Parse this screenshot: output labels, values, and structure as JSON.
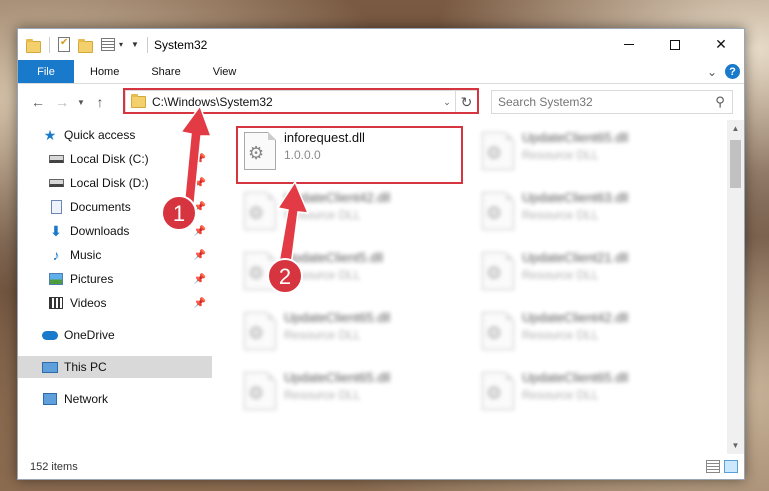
{
  "window": {
    "title": "System32"
  },
  "ribbon": {
    "tabs": [
      "File",
      "Home",
      "Share",
      "View"
    ],
    "help": "?"
  },
  "nav": {
    "address": "C:\\Windows\\System32",
    "search_placeholder": "Search System32"
  },
  "sidebar": {
    "items": [
      {
        "label": "Quick access",
        "icon": "star-icon"
      },
      {
        "label": "Local Disk (C:)",
        "icon": "disk-icon"
      },
      {
        "label": "Local Disk (D:)",
        "icon": "disk-icon"
      },
      {
        "label": "Documents",
        "icon": "documents-icon"
      },
      {
        "label": "Downloads",
        "icon": "download-icon"
      },
      {
        "label": "Music",
        "icon": "music-icon"
      },
      {
        "label": "Pictures",
        "icon": "pictures-icon"
      },
      {
        "label": "Videos",
        "icon": "videos-icon"
      },
      {
        "label": "OneDrive",
        "icon": "cloud-icon"
      },
      {
        "label": "This PC",
        "icon": "computer-icon"
      },
      {
        "label": "Network",
        "icon": "network-icon"
      }
    ]
  },
  "files": [
    {
      "name": "inforequest.dll",
      "sub": "1.0.0.0"
    },
    {
      "name": "UpdateClient65.dll",
      "sub": "Resource DLL"
    },
    {
      "name": "UpdateClient42.dll",
      "sub": "Resource DLL"
    },
    {
      "name": "UpdateClient63.dll",
      "sub": "Resource DLL"
    },
    {
      "name": "UpdateClient5.dll",
      "sub": "Resource DLL"
    },
    {
      "name": "UpdateClient21.dll",
      "sub": "Resource DLL"
    },
    {
      "name": "UpdateClient65.dll",
      "sub": "Resource DLL"
    },
    {
      "name": "UpdateClient42.dll",
      "sub": "Resource DLL"
    },
    {
      "name": "UpdateClient65.dll",
      "sub": "Resource DLL"
    },
    {
      "name": "UpdateClient65.dll",
      "sub": "Resource DLL"
    }
  ],
  "status": {
    "count": "152 items"
  },
  "annotations": {
    "badge1": "1",
    "badge2": "2",
    "color": "#d6343e"
  }
}
